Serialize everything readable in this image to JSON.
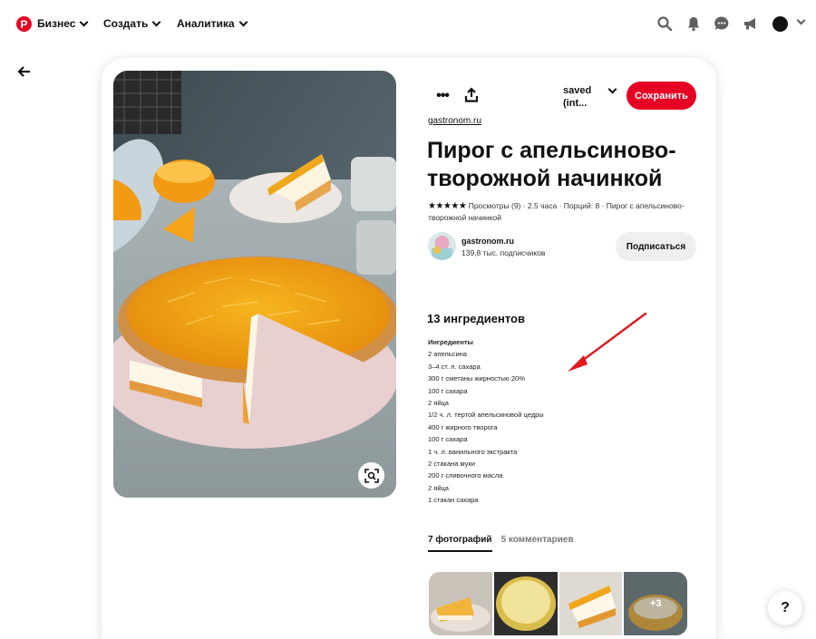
{
  "nav": {
    "logo_letter": "P",
    "items": [
      {
        "label": "Бизнес"
      },
      {
        "label": "Создать"
      },
      {
        "label": "Аналитика"
      }
    ]
  },
  "pin": {
    "board_label": "saved (int...",
    "save_label": "Сохранить",
    "source": "gastronom.ru",
    "title": "Пирог с апельсиново-творожной начинкой",
    "stars": "★★★★★",
    "meta": "Просмотры (9) · 2.5 часа · Порций: 8 · Пирог с апельсиново-творожной начинкой",
    "creator": {
      "name": "gastronom.ru",
      "subscribers": "139,8 тыс. подписчиков",
      "follow_label": "Подписаться"
    }
  },
  "ingredients": {
    "heading": "13 ингредиентов",
    "subheading": "Ингредиенты",
    "items": [
      "2 апельсина",
      "3–4 ст. л. сахара",
      "300 г сметаны жирностью 20%",
      "100 г сахара",
      "2 яйца",
      "1/2 ч. л. тертой апельсиновой цедры",
      "400 г жирного творога",
      "100 г сахара",
      "1 ч. л. ванильного экстракта",
      "2 стакана муки",
      "200 г сливочного масла",
      "2 яйца",
      "1 стакан сахара"
    ]
  },
  "tabs": [
    {
      "label": "7 фотографий"
    },
    {
      "label": "5 комментариев"
    }
  ],
  "thumbnails": {
    "more_count": "+3"
  },
  "help_label": "?",
  "colors": {
    "brand": "#e60023",
    "annotation_arrow": "#e0191f"
  },
  "icons": [
    "pinterest-logo-icon",
    "chevron-down-icon",
    "search-icon",
    "bell-icon",
    "messages-icon",
    "megaphone-icon",
    "back-arrow-icon",
    "more-icon",
    "share-icon",
    "lens-icon",
    "help-icon"
  ]
}
